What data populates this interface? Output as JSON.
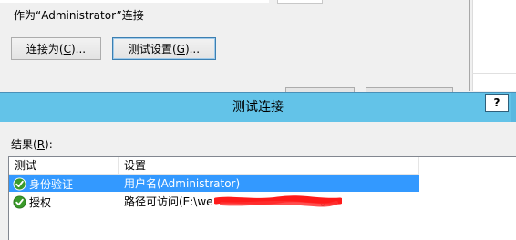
{
  "background_dialog": {
    "connect_as_text": "作为“Administrator”连接",
    "connect_as_button": {
      "text": "连接为(",
      "accel": "C",
      "suffix": ")..."
    },
    "test_settings_button": {
      "text": "测试设置(",
      "accel": "G",
      "suffix": ")..."
    }
  },
  "test_dialog": {
    "title": "测试连接",
    "help_label": "?",
    "results_label": {
      "text": "结果(",
      "accel": "R",
      "suffix": "):"
    },
    "columns": [
      "测试",
      "设置"
    ],
    "rows": [
      {
        "test": "身份验证",
        "setting": "用户名(Administrator)",
        "status": "success",
        "selected": true
      },
      {
        "test": "授权",
        "setting": "路径可访问(E:\\we",
        "setting_end": "。",
        "status": "success",
        "selected": false,
        "redacted": true
      }
    ]
  },
  "colors": {
    "titlebar": "#63c3e8",
    "selection": "#3399ff",
    "check_green": "#3a9a2a",
    "redaction_red": "#ff1a1a"
  }
}
